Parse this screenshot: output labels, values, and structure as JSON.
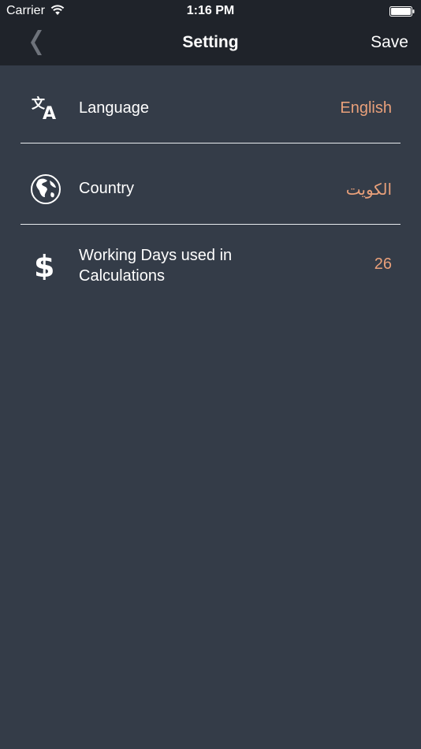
{
  "status_bar": {
    "carrier": "Carrier",
    "time": "1:16 PM"
  },
  "nav": {
    "title": "Setting",
    "save_label": "Save"
  },
  "settings": [
    {
      "icon": "translate-icon",
      "label": "Language",
      "value": "English"
    },
    {
      "icon": "globe-icon",
      "label": "Country",
      "value": "الكويت"
    },
    {
      "icon": "dollar-icon",
      "label": "Working Days used in Calculations",
      "value": "26"
    }
  ],
  "colors": {
    "background": "#343c48",
    "bar": "#1f232a",
    "accent": "#e9a07a"
  }
}
